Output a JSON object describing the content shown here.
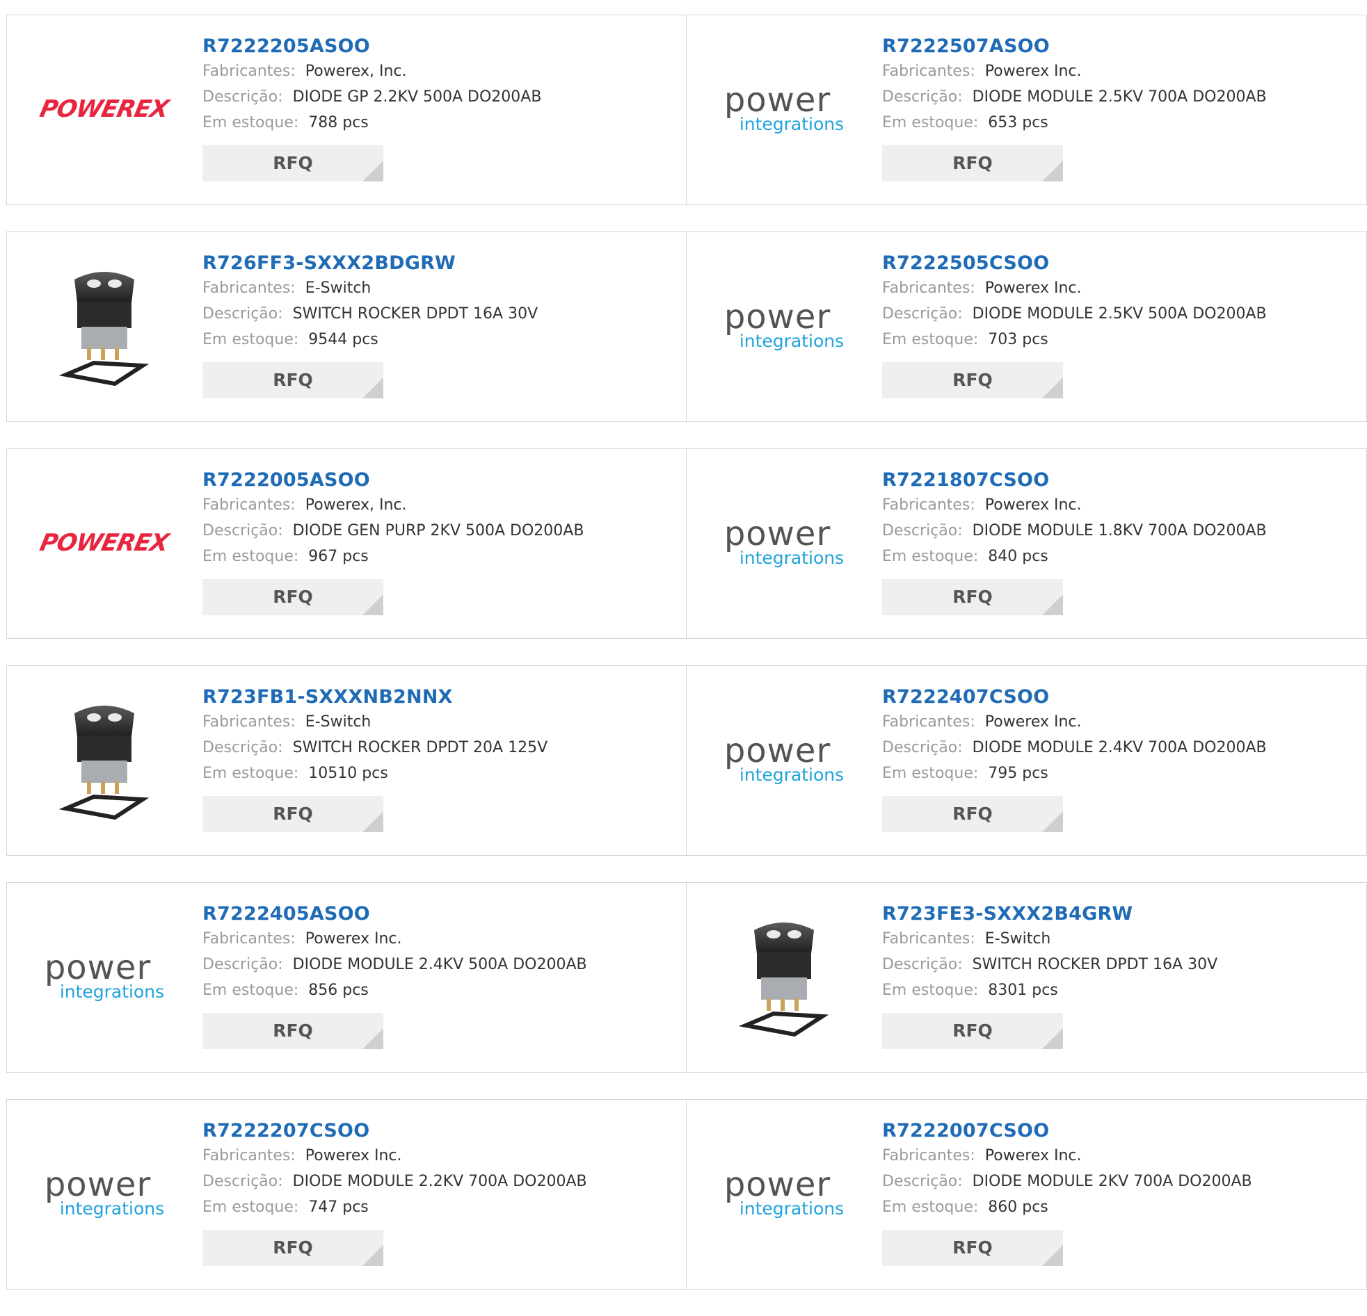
{
  "labels": {
    "manufacturer": "Fabricantes:",
    "description": "Descrição:",
    "stock": "Em estoque:",
    "rfq": "RFQ"
  },
  "brand_text": {
    "powerex": "POWEREX",
    "pi_top": "power",
    "pi_bottom": "integrations"
  },
  "colors": {
    "part_link": "#1f6bb6",
    "powerex_red": "#e8253f",
    "pi_blue": "#1fa3dc"
  },
  "products": [
    {
      "part": "R7222205ASOO",
      "manufacturer": "Powerex, Inc.",
      "description": "DIODE GP 2.2KV 500A DO200AB",
      "stock": "788 pcs",
      "logo": "powerex-logo"
    },
    {
      "part": "R7222507ASOO",
      "manufacturer": "Powerex Inc.",
      "description": "DIODE MODULE 2.5KV 700A DO200AB",
      "stock": "653 pcs",
      "logo": "power-integrations-logo"
    },
    {
      "part": "R726FF3-SXXX2BDGRW",
      "manufacturer": "E-Switch",
      "description": "SWITCH ROCKER DPDT 16A 30V",
      "stock": "9544 pcs",
      "logo": "rocker-switch-image"
    },
    {
      "part": "R7222505CSOO",
      "manufacturer": "Powerex Inc.",
      "description": "DIODE MODULE 2.5KV 500A DO200AB",
      "stock": "703 pcs",
      "logo": "power-integrations-logo"
    },
    {
      "part": "R7222005ASOO",
      "manufacturer": "Powerex, Inc.",
      "description": "DIODE GEN PURP 2KV 500A DO200AB",
      "stock": "967 pcs",
      "logo": "powerex-logo"
    },
    {
      "part": "R7221807CSOO",
      "manufacturer": "Powerex Inc.",
      "description": "DIODE MODULE 1.8KV 700A DO200AB",
      "stock": "840 pcs",
      "logo": "power-integrations-logo"
    },
    {
      "part": "R723FB1-SXXXNB2NNX",
      "manufacturer": "E-Switch",
      "description": "SWITCH ROCKER DPDT 20A 125V",
      "stock": "10510 pcs",
      "logo": "rocker-switch-image"
    },
    {
      "part": "R7222407CSOO",
      "manufacturer": "Powerex Inc.",
      "description": "DIODE MODULE 2.4KV 700A DO200AB",
      "stock": "795 pcs",
      "logo": "power-integrations-logo"
    },
    {
      "part": "R7222405ASOO",
      "manufacturer": "Powerex Inc.",
      "description": "DIODE MODULE 2.4KV 500A DO200AB",
      "stock": "856 pcs",
      "logo": "power-integrations-logo"
    },
    {
      "part": "R723FE3-SXXX2B4GRW",
      "manufacturer": "E-Switch",
      "description": "SWITCH ROCKER DPDT 16A 30V",
      "stock": "8301 pcs",
      "logo": "rocker-switch-image"
    },
    {
      "part": "R7222207CSOO",
      "manufacturer": "Powerex Inc.",
      "description": "DIODE MODULE 2.2KV 700A DO200AB",
      "stock": "747 pcs",
      "logo": "power-integrations-logo"
    },
    {
      "part": "R7222007CSOO",
      "manufacturer": "Powerex Inc.",
      "description": "DIODE MODULE 2KV 700A DO200AB",
      "stock": "860 pcs",
      "logo": "power-integrations-logo"
    }
  ]
}
